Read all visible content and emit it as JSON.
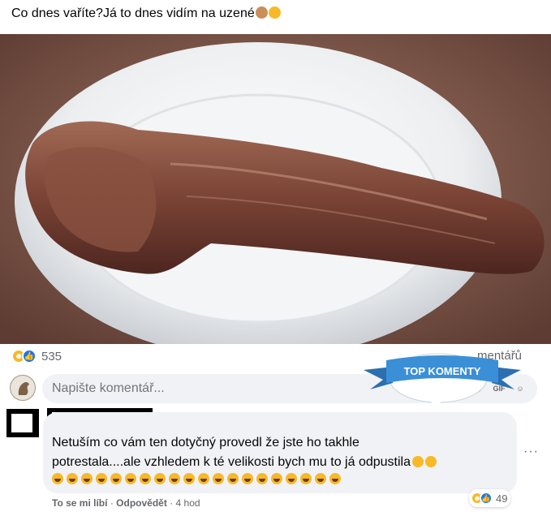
{
  "post": {
    "text": "Co dnes vaříte?Já to dnes vidím na uzené",
    "emojis": [
      "see-no-evil-monkey",
      "grinning-face"
    ]
  },
  "reactions": {
    "icons": [
      "haha",
      "like"
    ],
    "count": "535",
    "comments_count": "mentářů"
  },
  "composer": {
    "placeholder": "Napište komentář...",
    "icons": [
      "emoji-icon",
      "camera-icon",
      "gif-icon",
      "sticker-icon"
    ],
    "gif_label": "GIF"
  },
  "badge": {
    "label": "TOP KOMENTY"
  },
  "comment": {
    "line1": "Netuším co vám ten dotyčný provedl že jste ho takhle",
    "line2": "potrestala....ale vzhledem k té velikosti bych mu to já odpustila",
    "emoji_count": 20,
    "reaction_count": "49",
    "like_label": "To se mi líbí",
    "reply_label": "Odpovědět",
    "separator": "·",
    "time": "4 hod",
    "more": "···"
  },
  "colors": {
    "text": "#050505",
    "secondary": "#65676b",
    "like_blue": "#1877f2",
    "haha_yellow": "#f7b928",
    "badge_blue": "#3b8fd6",
    "input_bg": "#f0f2f5"
  }
}
